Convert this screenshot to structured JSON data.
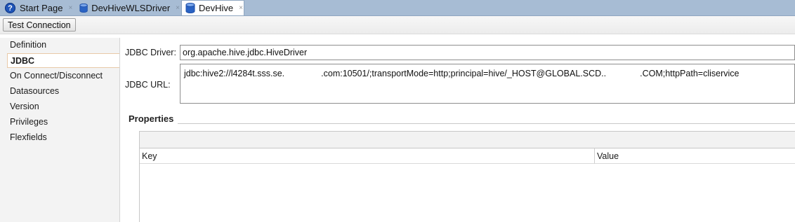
{
  "tabs": [
    {
      "label": "Start Page",
      "icon": "help-icon"
    },
    {
      "label": "DevHiveWLSDriver",
      "icon": "database-icon"
    },
    {
      "label": "DevHive",
      "icon": "database-icon",
      "active": true
    }
  ],
  "close_glyph": "×",
  "toolbar": {
    "test_connection_label": "Test Connection"
  },
  "sidebar": {
    "items": [
      {
        "label": "Definition"
      },
      {
        "label": "JDBC",
        "selected": true
      },
      {
        "label": "On Connect/Disconnect"
      },
      {
        "label": "Datasources"
      },
      {
        "label": "Version"
      },
      {
        "label": "Privileges"
      },
      {
        "label": "Flexfields"
      }
    ]
  },
  "jdbc": {
    "driver_label": "JDBC Driver:",
    "driver_value": "org.apache.hive.jdbc.HiveDriver",
    "url_label": "JDBC URL:",
    "url_part1": "jdbc:hive2://l4284t.sss.se.",
    "url_part2": ".com:10501/;transportMode=http;principal=hive/_HOST@GLOBAL.SCD..",
    "url_part3": ".COM;httpPath=cliservice"
  },
  "properties": {
    "title": "Properties",
    "columns": [
      "Key",
      "Value"
    ],
    "rows": []
  },
  "colors": {
    "tabstrip": "#a7bcd4",
    "selected_border": "#e8c9a8",
    "help_icon": "#1f55b8",
    "db_icon": "#2a63c4"
  }
}
